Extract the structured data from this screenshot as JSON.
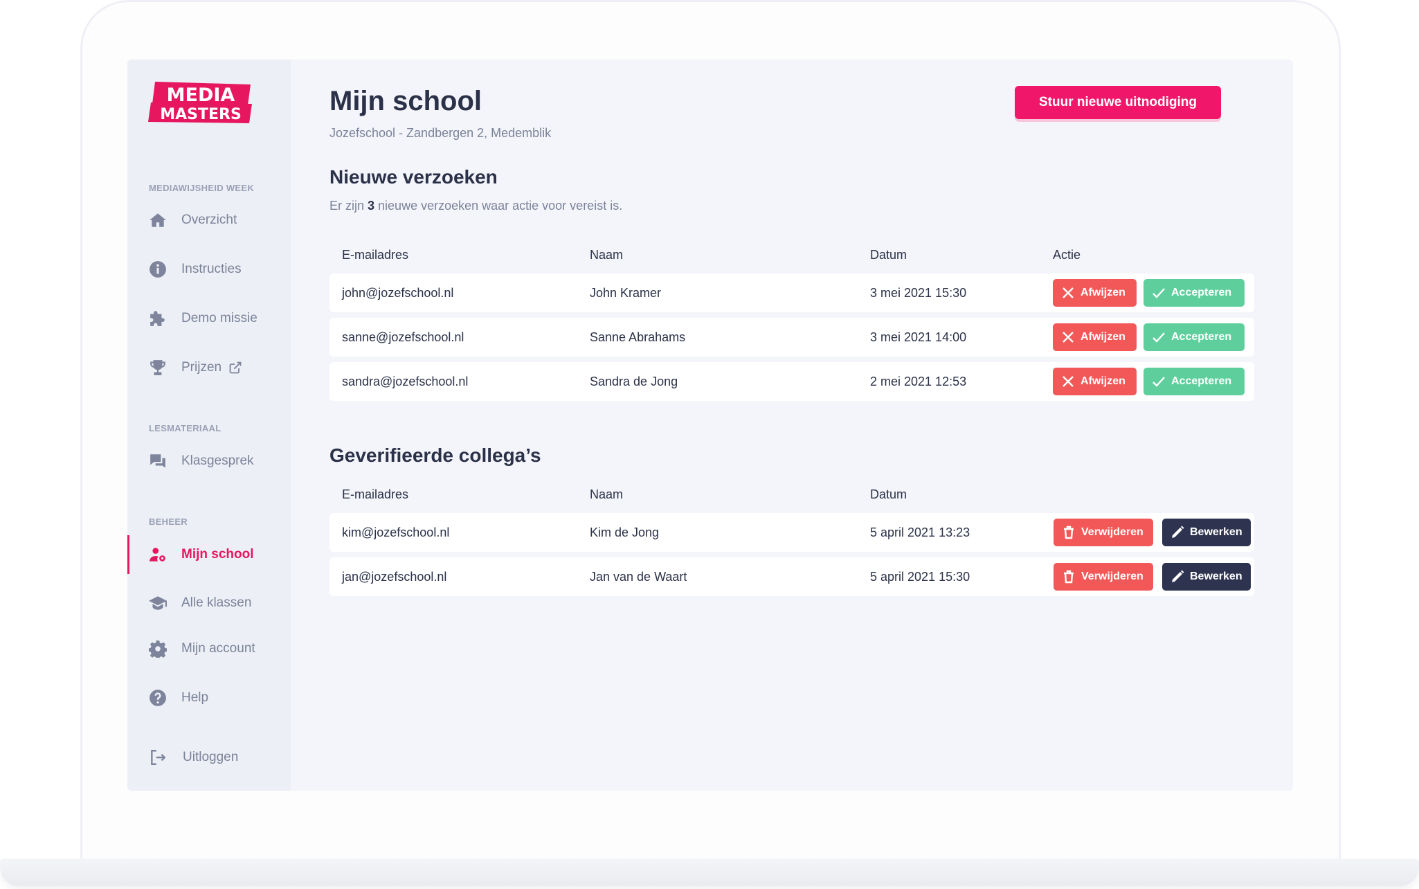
{
  "brand": {
    "logo_line1": "MEDIA",
    "logo_line2": "MASTERS",
    "primary": "#f0176a",
    "dark": "#2b3148"
  },
  "sidebar": {
    "sections": [
      {
        "label": "MEDIAWIJSHEID WEEK"
      },
      {
        "label": "LESMATERIAAL"
      },
      {
        "label": "BEHEER"
      }
    ],
    "items": [
      {
        "label": "Overzicht",
        "icon": "home-icon"
      },
      {
        "label": "Instructies",
        "icon": "info-icon"
      },
      {
        "label": "Demo missie",
        "icon": "puzzle-icon"
      },
      {
        "label": "Prijzen",
        "icon": "trophy-icon"
      },
      {
        "label": "Klasgesprek",
        "icon": "chat-icon"
      },
      {
        "label": "Mijn school",
        "icon": "user-gear-icon",
        "active": true
      },
      {
        "label": "Alle klassen",
        "icon": "graduation-cap-icon"
      },
      {
        "label": "Mijn account",
        "icon": "gear-icon"
      },
      {
        "label": "Help",
        "icon": "question-icon"
      },
      {
        "label": "Uitloggen",
        "icon": "logout-icon"
      }
    ]
  },
  "main": {
    "title": "Mijn school",
    "subtitle": "Jozefschool - Zandbergen 2, Medemblik",
    "invite_button": "Stuur nieuwe uitnodiging",
    "requests": {
      "title": "Nieuwe verzoeken",
      "info_prefix": "Er zijn ",
      "info_count": "3",
      "info_suffix": " nieuwe verzoeken waar actie voor vereist is.",
      "columns": [
        "E-mailadres",
        "Naam",
        "Datum",
        "Actie"
      ],
      "rows": [
        {
          "email": "john@jozefschool.nl",
          "name": "John Kramer",
          "date": "3 mei 2021 15:30"
        },
        {
          "email": "sanne@jozefschool.nl",
          "name": "Sanne Abrahams",
          "date": "3 mei 2021 14:00"
        },
        {
          "email": "sandra@jozefschool.nl",
          "name": "Sandra de Jong",
          "date": "2 mei 2021 12:53"
        }
      ],
      "reject_label": "Afwijzen",
      "accept_label": "Accepteren"
    },
    "verified": {
      "title": "Geverifieerde collega’s",
      "columns": [
        "E-mailadres",
        "Naam",
        "Datum"
      ],
      "rows": [
        {
          "email": "kim@jozefschool.nl",
          "name": "Kim de Jong",
          "date": "5 april 2021 13:23"
        },
        {
          "email": "jan@jozefschool.nl",
          "name": "Jan van de Waart",
          "date": "5 april 2021 15:30"
        }
      ],
      "remove_label": "Verwijderen",
      "edit_label": "Bewerken"
    }
  }
}
